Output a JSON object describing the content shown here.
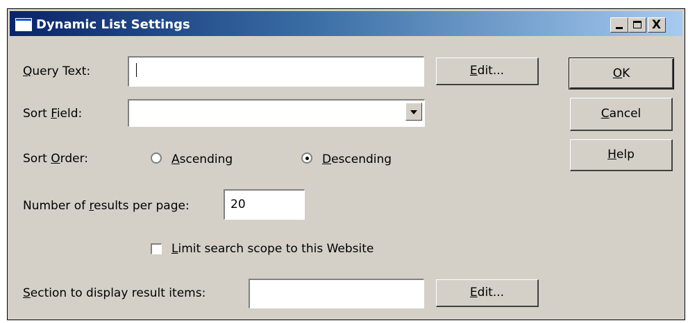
{
  "window": {
    "title": "Dynamic List Settings",
    "controls": {
      "minimize": "_",
      "maximize": "□",
      "close": "X"
    }
  },
  "query_text": {
    "label_prefix": "",
    "label_mnemonic": "Q",
    "label_rest": "uery Text:",
    "value": "",
    "edit_button": {
      "mnemonic": "E",
      "rest": "dit..."
    }
  },
  "sort_field": {
    "label_prefix": "Sort ",
    "label_mnemonic": "F",
    "label_rest": "ield:",
    "selected": ""
  },
  "sort_order": {
    "label_prefix": "Sort ",
    "label_mnemonic": "O",
    "label_rest": "rder:",
    "options": [
      {
        "mnemonic": "A",
        "rest": "scending",
        "selected": false
      },
      {
        "mnemonic": "D",
        "rest": "escending",
        "selected": true
      }
    ]
  },
  "results_per_page": {
    "label_prefix": "Number of ",
    "label_mnemonic": "r",
    "label_rest": "esults per page:",
    "value": "20"
  },
  "limit_scope": {
    "mnemonic": "L",
    "rest": "imit search scope to this Website",
    "checked": false
  },
  "section_display": {
    "label_prefix": "",
    "label_mnemonic": "S",
    "label_rest": "ection to display result items:",
    "value": "",
    "edit_button": {
      "mnemonic": "E",
      "rest": "dit..."
    }
  },
  "buttons": {
    "ok": {
      "mnemonic": "O",
      "rest": "K"
    },
    "cancel": {
      "mnemonic": "C",
      "rest": "ancel"
    },
    "help": {
      "mnemonic": "H",
      "rest": "elp"
    }
  },
  "colors": {
    "title_start": "#0a246a",
    "title_end": "#a6caf0",
    "face": "#d4d0c8"
  }
}
